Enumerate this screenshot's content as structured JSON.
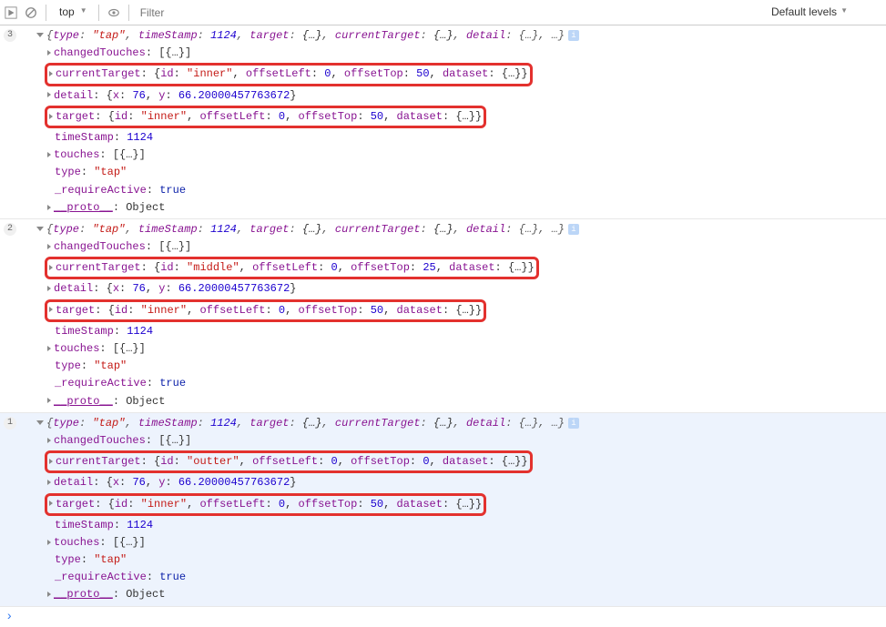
{
  "toolbar": {
    "context": "top",
    "filter_placeholder": "Filter",
    "levels_label": "Default levels"
  },
  "entries": [
    {
      "count": "3",
      "highlighted": false,
      "summary_type": "tap",
      "summary_ts": "1124",
      "lines": [
        {
          "kind": "child",
          "hl": false,
          "label": "changedTouches",
          "val_text": "[{…}]",
          "val_cls": "k-obj"
        },
        {
          "kind": "child",
          "hl": true,
          "label": "currentTarget",
          "obj": {
            "id": "inner",
            "offsetLeft": "0",
            "offsetTop": "50"
          }
        },
        {
          "kind": "child",
          "hl": false,
          "label": "detail",
          "detail": {
            "x": "76",
            "y": "66.20000457763672"
          }
        },
        {
          "kind": "child",
          "hl": true,
          "label": "target",
          "obj": {
            "id": "inner",
            "offsetLeft": "0",
            "offsetTop": "50"
          }
        },
        {
          "kind": "plain",
          "label": "timeStamp",
          "val_text": "1124",
          "val_cls": "k-num"
        },
        {
          "kind": "child",
          "hl": false,
          "label": "touches",
          "val_text": "[{…}]",
          "val_cls": "k-obj"
        },
        {
          "kind": "plain",
          "label": "type",
          "val_text": "\"tap\"",
          "val_cls": "k-str"
        },
        {
          "kind": "plain",
          "label": "_requireActive",
          "val_text": "true",
          "val_cls": "k-kw"
        },
        {
          "kind": "child",
          "hl": false,
          "label": "__proto__",
          "val_text": "Object",
          "val_cls": "k-obj",
          "underline": true
        }
      ]
    },
    {
      "count": "2",
      "highlighted": false,
      "summary_type": "tap",
      "summary_ts": "1124",
      "lines": [
        {
          "kind": "child",
          "hl": false,
          "label": "changedTouches",
          "val_text": "[{…}]",
          "val_cls": "k-obj"
        },
        {
          "kind": "child",
          "hl": true,
          "label": "currentTarget",
          "obj": {
            "id": "middle",
            "offsetLeft": "0",
            "offsetTop": "25"
          }
        },
        {
          "kind": "child",
          "hl": false,
          "label": "detail",
          "detail": {
            "x": "76",
            "y": "66.20000457763672"
          }
        },
        {
          "kind": "child",
          "hl": true,
          "label": "target",
          "obj": {
            "id": "inner",
            "offsetLeft": "0",
            "offsetTop": "50"
          }
        },
        {
          "kind": "plain",
          "label": "timeStamp",
          "val_text": "1124",
          "val_cls": "k-num"
        },
        {
          "kind": "child",
          "hl": false,
          "label": "touches",
          "val_text": "[{…}]",
          "val_cls": "k-obj"
        },
        {
          "kind": "plain",
          "label": "type",
          "val_text": "\"tap\"",
          "val_cls": "k-str"
        },
        {
          "kind": "plain",
          "label": "_requireActive",
          "val_text": "true",
          "val_cls": "k-kw"
        },
        {
          "kind": "child",
          "hl": false,
          "label": "__proto__",
          "val_text": "Object",
          "val_cls": "k-obj",
          "underline": true
        }
      ]
    },
    {
      "count": "1",
      "highlighted": true,
      "summary_type": "tap",
      "summary_ts": "1124",
      "lines": [
        {
          "kind": "child",
          "hl": false,
          "label": "changedTouches",
          "val_text": "[{…}]",
          "val_cls": "k-obj"
        },
        {
          "kind": "child",
          "hl": true,
          "label": "currentTarget",
          "obj": {
            "id": "outter",
            "offsetLeft": "0",
            "offsetTop": "0"
          }
        },
        {
          "kind": "child",
          "hl": false,
          "label": "detail",
          "detail": {
            "x": "76",
            "y": "66.20000457763672"
          }
        },
        {
          "kind": "child",
          "hl": true,
          "label": "target",
          "obj": {
            "id": "inner",
            "offsetLeft": "0",
            "offsetTop": "50"
          }
        },
        {
          "kind": "plain",
          "label": "timeStamp",
          "val_text": "1124",
          "val_cls": "k-num"
        },
        {
          "kind": "child",
          "hl": false,
          "label": "touches",
          "val_text": "[{…}]",
          "val_cls": "k-obj"
        },
        {
          "kind": "plain",
          "label": "type",
          "val_text": "\"tap\"",
          "val_cls": "k-str"
        },
        {
          "kind": "plain",
          "label": "_requireActive",
          "val_text": "true",
          "val_cls": "k-kw"
        },
        {
          "kind": "child",
          "hl": false,
          "label": "__proto__",
          "val_text": "Object",
          "val_cls": "k-obj",
          "underline": true
        }
      ]
    }
  ],
  "strings": {
    "target": "target",
    "currentTarget": "currentTarget",
    "detail": "detail",
    "summary_rest": ": {…}, …}",
    "ellipsis": "{…}",
    "datasetLbl": "dataset",
    "offsetLeftLbl": "offsetLeft",
    "offsetTopLbl": "offsetTop",
    "idLbl": "id",
    "typeLbl": "type",
    "tsLbl": "timeStamp",
    "xLbl": "x",
    "yLbl": "y"
  }
}
